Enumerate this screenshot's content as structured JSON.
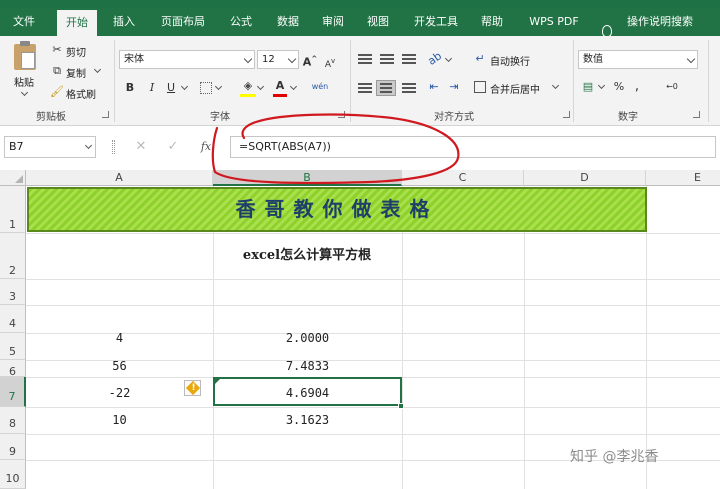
{
  "ribbon_tabs": [
    "文件",
    "开始",
    "插入",
    "页面布局",
    "公式",
    "数据",
    "审阅",
    "视图",
    "开发工具",
    "帮助",
    "WPS PDF",
    "操作说明搜索"
  ],
  "active_tab": "开始",
  "clipboard": {
    "paste": "粘贴",
    "cut": "剪切",
    "copy": "复制",
    "format_painter": "格式刷",
    "label": "剪贴板"
  },
  "font": {
    "name": "宋体",
    "size": "12",
    "bold": "B",
    "italic": "I",
    "underline": "U",
    "grow": "A",
    "shrink": "A",
    "label": "字体"
  },
  "alignment": {
    "wrap": "自动换行",
    "merge": "合并后居中",
    "label": "对齐方式"
  },
  "number": {
    "format": "数值",
    "percent": "%",
    "label": "数字"
  },
  "formula_bar": {
    "name_box": "B7",
    "fx": "fx",
    "formula": "=SQRT(ABS(A7))"
  },
  "columns": [
    "A",
    "B",
    "C",
    "D",
    "E"
  ],
  "selected_column": "B",
  "rows": [
    "1",
    "2",
    "3",
    "4",
    "5",
    "6",
    "7",
    "8",
    "9",
    "10"
  ],
  "selected_row": "7",
  "sheet": {
    "banner_title": "香哥教你做表格",
    "heading": "excel怎么计算平方根",
    "a_values": [
      "4",
      "56",
      "-22",
      "10"
    ],
    "b_values": [
      "2.0000",
      "7.4833",
      "4.6904",
      "3.1623"
    ]
  },
  "watermark": "知乎 @李兆香",
  "colors": {
    "excel_green": "#217346",
    "banner_green": "#8fd12c",
    "banner_text": "#1d3f6a",
    "annotation_red": "#d0191f",
    "warning": "#e8a80c"
  }
}
